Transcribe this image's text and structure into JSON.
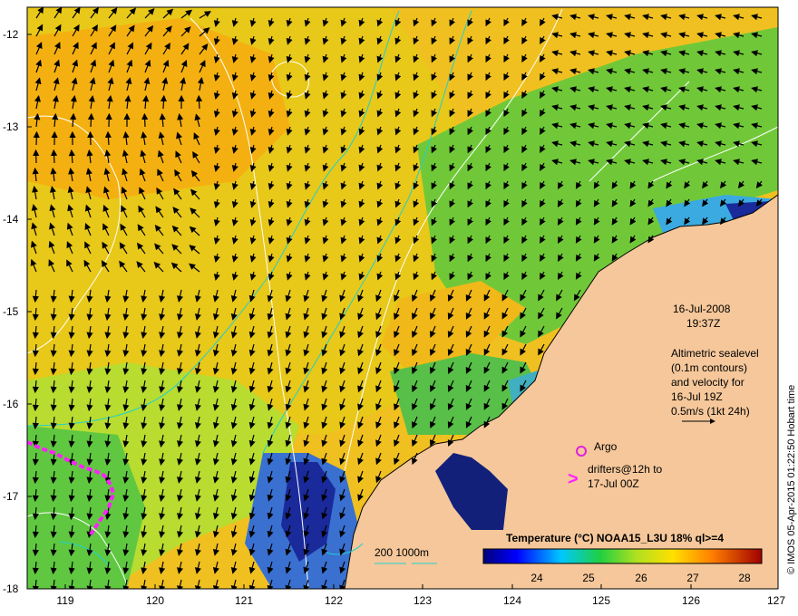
{
  "map": {
    "lon_ticks": [
      "119",
      "120",
      "121",
      "122",
      "123",
      "124",
      "125",
      "126",
      "127"
    ],
    "lat_ticks": [
      "-12",
      "-13",
      "-14",
      "-15",
      "-16",
      "-17",
      "-18"
    ],
    "lon_range": [
      118.6,
      127.0
    ],
    "lat_range": [
      -18.0,
      -11.7
    ]
  },
  "annotations": {
    "date": "16-Jul-2008",
    "time": "19:37Z",
    "altimetry_line1": "Altimetric sealevel",
    "altimetry_line2": "(0.1m contours)",
    "altimetry_line3": "and velocity for",
    "altimetry_line4": "16-Jul 19Z",
    "altimetry_line5": "0.5m/s (1kt 24h)",
    "argo_label": "Argo",
    "drifters_line1": "drifters@12h to",
    "drifters_line2": "17-Jul 00Z",
    "drifter_marker": ">",
    "isobath_label": "200  1000m",
    "credit": "© IMOS 05-Apr-2015 01:22:50 Hobart time"
  },
  "colorbar": {
    "title": "Temperature (°C) NOAA15_L3U 18% ql>=4",
    "ticks": [
      "24",
      "25",
      "26",
      "27",
      "28"
    ],
    "range": [
      22.8,
      28.4
    ]
  },
  "colors": {
    "land": "#f5c79a",
    "warm": "#f0b800",
    "mid": "#d8e020",
    "cool": "#4cc040",
    "cold": "#101090",
    "contour": "#ffffff",
    "isobath": "#20d0d0",
    "drifter": "#ff20ff",
    "argo": "#e020e0",
    "arrow": "#000000"
  }
}
